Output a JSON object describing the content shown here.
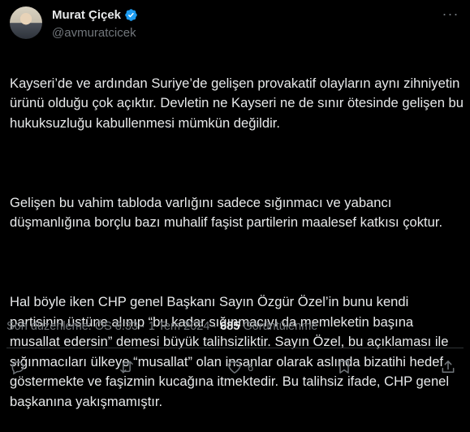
{
  "author": {
    "name": "Murat Çiçek",
    "handle": "@avmuratcicek",
    "verified": true
  },
  "tweet": {
    "paragraphs": [
      "Kayseri’de ve ardından Suriye’de gelişen provakatif olayların aynı zihniyetin ürünü olduğu çok açıktır. Devletin ne Kayseri ne de sınır ötesinde gelişen bu hukuksuzluğu kabullenmesi mümkün değildir.",
      "Gelişen bu vahim tabloda varlığını sadece sığınmacı ve yabancı düşmanlığına borçlu bazı muhalif faşist partilerin maalesef katkısı çoktur.",
      "Hal böyle iken CHP genel Başkanı Sayın Özgür Özel’in bunu kendi partisinin üstüne alınıp “bu kadar sığınmacıyı da memleketin başına musallat edersin” demesi büyük talihsizliktir. Sayın Özel, bu açıklaması ile sığınmacıları  ülkeye “musallat” olan insanlar olarak aslında bizatihi hedef göstermekte ve faşizmin kucağına itmektedir. Bu talihsiz ifade, CHP genel başkanına yakışmamıştır."
    ]
  },
  "meta": {
    "edited_label": "Son düzenleme: ÖS 8:33",
    "separator": "·",
    "date": "1 Tem 2024",
    "views_count": "685",
    "views_label": "Görüntülenme"
  },
  "actions": {
    "reply": "",
    "retweet": "",
    "like": "6",
    "bookmark": "",
    "share": ""
  },
  "colors": {
    "background": "#000000",
    "text": "#e7e9ea",
    "muted": "#71767b",
    "verified": "#1d9bf0"
  }
}
